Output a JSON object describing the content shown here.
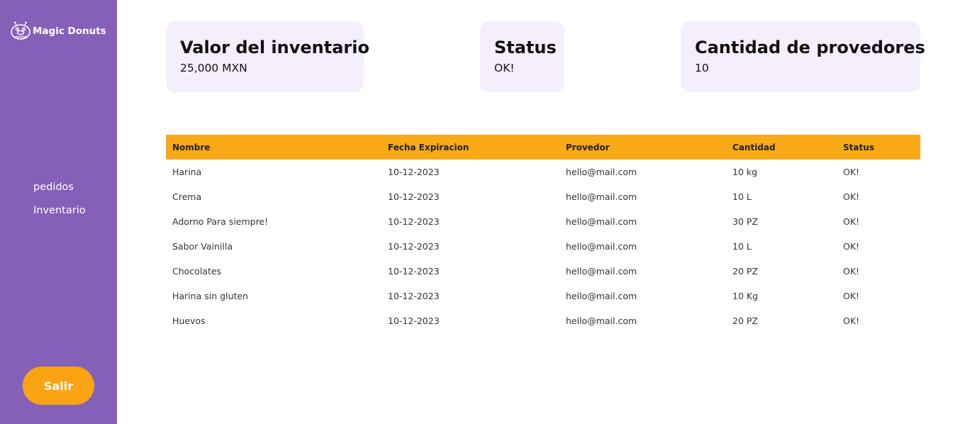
{
  "brand": {
    "name": "Magic Donuts",
    "logo_icon": "donut-monster-icon"
  },
  "nav": {
    "items": [
      {
        "label": "pedidos"
      },
      {
        "label": "Inventario"
      }
    ]
  },
  "logout": {
    "label": "Salir"
  },
  "colors": {
    "sidebar": "#8560b9",
    "accent": "#faa414",
    "table_header": "#f9a915",
    "card_bg": "#f5effd"
  },
  "cards": {
    "inventory": {
      "title": "Valor del inventario",
      "value": "25,000 MXN"
    },
    "status": {
      "title": "Status",
      "value": "OK!"
    },
    "suppliers": {
      "title": "Cantidad de provedores",
      "value": "10"
    }
  },
  "table": {
    "headers": [
      "Nombre",
      "Fecha Expiracion",
      "Provedor",
      "Cantidad",
      "Status"
    ],
    "rows": [
      [
        "Harina",
        "10-12-2023",
        "hello@mail.com",
        "10 kg",
        "OK!"
      ],
      [
        "Crema",
        "10-12-2023",
        "hello@mail.com",
        "10 L",
        "OK!"
      ],
      [
        "Adorno Para siempre!",
        "10-12-2023",
        "hello@mail.com",
        "30 PZ",
        "OK!"
      ],
      [
        "Sabor Vainilla",
        "10-12-2023",
        "hello@mail.com",
        "10 L",
        "OK!"
      ],
      [
        "Chocolates",
        "10-12-2023",
        "hello@mail.com",
        "20 PZ",
        "OK!"
      ],
      [
        "Harina sin gluten",
        "10-12-2023",
        "hello@mail.com",
        "10 Kg",
        "OK!"
      ],
      [
        "Huevos",
        "10-12-2023",
        "hello@mail.com",
        "20 PZ",
        "OK!"
      ]
    ]
  }
}
